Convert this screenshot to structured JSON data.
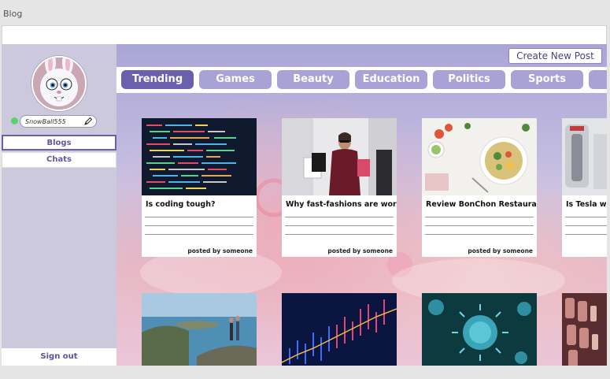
{
  "app": {
    "title": "Blog"
  },
  "sidebar": {
    "username": "SnowBall555",
    "nav": [
      {
        "label": "Blogs"
      },
      {
        "label": "Chats"
      }
    ],
    "signout_label": "Sign out"
  },
  "header": {
    "create_label": "Create New Post"
  },
  "categories": [
    {
      "label": "Trending",
      "active": true
    },
    {
      "label": "Games"
    },
    {
      "label": "Beauty"
    },
    {
      "label": "Education"
    },
    {
      "label": "Politics"
    },
    {
      "label": "Sports"
    },
    {
      "label": ""
    }
  ],
  "posts": [
    {
      "title": "Is coding tough?",
      "byline": "posted by someone"
    },
    {
      "title": "Why fast-fashions are worst!",
      "byline": "posted by someone"
    },
    {
      "title": "Review BonChon Restaurant",
      "byline": "posted by someone"
    },
    {
      "title": "Is Tesla wo",
      "byline": ""
    },
    {
      "title": "",
      "byline": ""
    },
    {
      "title": "",
      "byline": ""
    },
    {
      "title": "",
      "byline": ""
    },
    {
      "title": "",
      "byline": ""
    }
  ],
  "colors": {
    "accent": "#6a60ad",
    "tab": "#a9a2d6",
    "sidebar": "#ccc9dd",
    "online": "#59d36b"
  },
  "icons": {
    "edit": "pencil-icon",
    "status": "online-status-icon"
  }
}
